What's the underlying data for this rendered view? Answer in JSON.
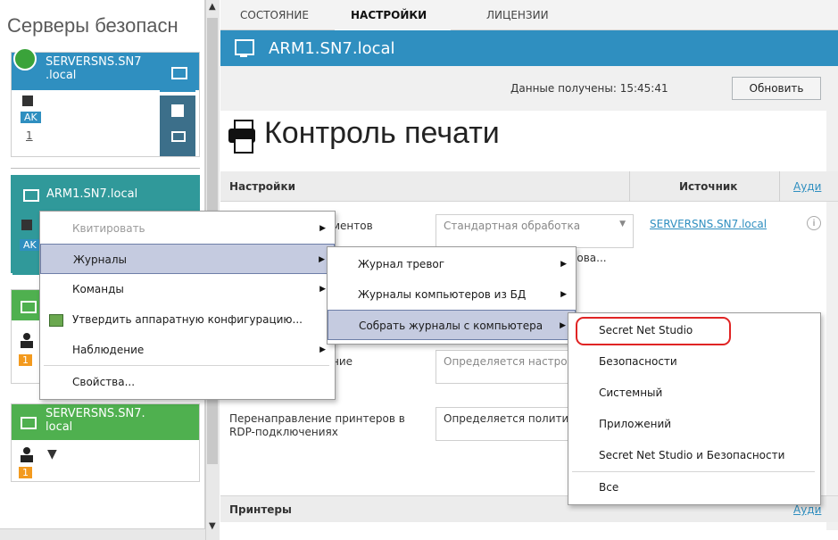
{
  "left": {
    "title": "Серверы безопасн",
    "card1": {
      "title": "SERVERSNS.SN7\n.local",
      "badge": "AK",
      "count": "1"
    },
    "card2": {
      "title": "ARM1.SN7.local",
      "badge": "AK"
    },
    "card4": {
      "title": "SERVERSNS.SN7.\nlocal",
      "count": "1"
    }
  },
  "tabs": [
    "СОСТОЯНИЕ",
    "НАСТРОЙКИ",
    "ЛИЦЕНЗИИ"
  ],
  "header": {
    "title": "ARM1.SN7.local"
  },
  "toolbar": {
    "received": "Данные получены: 15:45:41",
    "refresh": "Обновить"
  },
  "page_title": "Контроль печати",
  "table": {
    "col_settings": "Настройки",
    "col_source": "Источник",
    "col_audit": "Ауди",
    "row1_label": "ментов",
    "row1_value": "Стандартная обработка",
    "row1_source": "SERVERSNS.SN7.local",
    "row2_label": "зова...",
    "row3_label": "ние",
    "row3_value": "Определяется настро",
    "row4_label": "Перенаправление принтеров в RDP-подключениях",
    "row4_value": "Определяется полити",
    "printers": "Принтеры",
    "printers_audit": "Ауди"
  },
  "menu1": [
    {
      "label": "Квитировать",
      "disabled": true,
      "arrow": true
    },
    {
      "label": "Журналы",
      "disabled": false,
      "arrow": true
    },
    {
      "label": "Команды",
      "disabled": false,
      "arrow": true
    },
    {
      "label": "Утвердить аппаратную конфигурацию...",
      "disabled": false,
      "arrow": false
    },
    {
      "label": "Наблюдение",
      "disabled": false,
      "arrow": true
    },
    {
      "label": "Свойства...",
      "disabled": false,
      "arrow": false
    }
  ],
  "menu2": [
    {
      "label": "Журнал тревог"
    },
    {
      "label": "Журналы компьютеров из БД"
    },
    {
      "label": "Собрать журналы с компьютера"
    }
  ],
  "menu3": [
    {
      "label": "Secret Net Studio"
    },
    {
      "label": "Безопасности"
    },
    {
      "label": "Системный"
    },
    {
      "label": "Приложений"
    },
    {
      "label": "Secret Net Studio и Безопасности"
    },
    {
      "label": "Все"
    }
  ],
  "colors": {
    "accent": "#2f8fc0",
    "teal": "#30999a",
    "green": "#4fb04f",
    "highlight_ring": "#e02424"
  }
}
